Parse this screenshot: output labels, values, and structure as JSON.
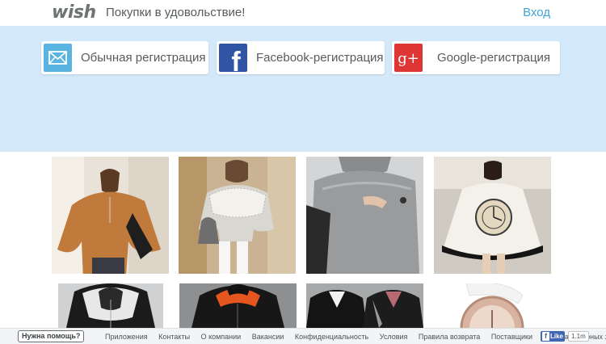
{
  "header": {
    "logo_text": "wish",
    "tagline": "Покупки в удовольствие!",
    "login_label": "Вход"
  },
  "registration": {
    "email_label": "Обычная регистрация",
    "facebook_label": "Facebook-регистрация",
    "google_label": "Google-регистрация",
    "email_icon": "envelope-icon",
    "facebook_icon": "facebook-icon",
    "google_icon": "google-plus-icon",
    "google_icon_text": "g+",
    "facebook_icon_text": "f"
  },
  "colors": {
    "accent": "#3fa5d9",
    "hero_bg": "#d3e8f8",
    "facebook": "#2f55a4",
    "google": "#dd3634",
    "email": "#5ab4e1"
  },
  "products": [
    {
      "kind": "orange-batwing-sweater"
    },
    {
      "kind": "lace-top-with-handbag"
    },
    {
      "kind": "grey-knit-sweater"
    },
    {
      "kind": "white-tunic-with-clock-print"
    },
    {
      "kind": "black-white-hoodie"
    },
    {
      "kind": "black-orange-hooded-jacket"
    },
    {
      "kind": "black-jackets-pair"
    },
    {
      "kind": "rose-gold-wristwatch"
    }
  ],
  "footer": {
    "help_label": "Нужна помощь?",
    "links": [
      "Приложения",
      "Контакты",
      "О компании",
      "Вакансии",
      "Конфиденциальность",
      "Условия",
      "Правила возврата",
      "Поставщики",
      "Охрана товарных знаков"
    ],
    "like_label": "Like",
    "like_count": "1.1m"
  }
}
